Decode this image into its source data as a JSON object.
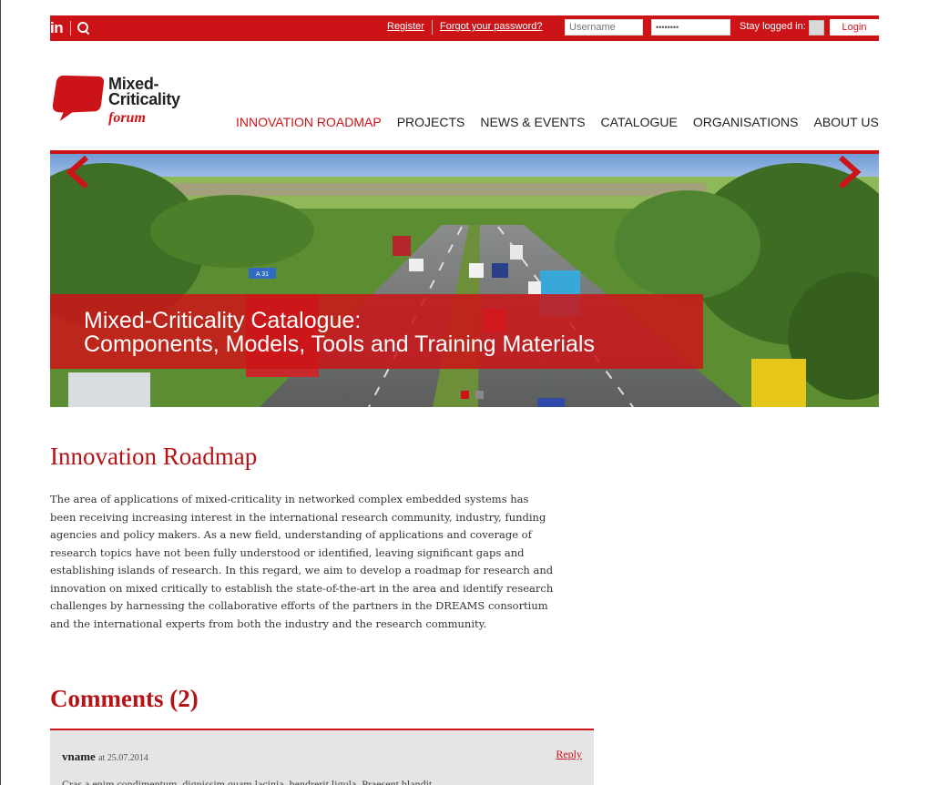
{
  "topbar": {
    "linkedin": "in",
    "register": "Register",
    "forgot": "Forgot your password?",
    "username_placeholder": "Username",
    "password_value": "••••••••",
    "stay_logged": "Stay logged in:",
    "login": "Login"
  },
  "logo": {
    "line1": "Mixed-",
    "line2": "Criticality",
    "line3": "forum"
  },
  "nav": [
    "INNOVATION ROADMAP",
    "PROJECTS",
    "NEWS & EVENTS",
    "CATALOGUE",
    "ORGANISATIONS",
    "ABOUT US"
  ],
  "hero": {
    "line1": "Mixed-Criticality Catalogue:",
    "line2": "Components, Models, Tools and Training Materials",
    "road_sign": "A 31"
  },
  "content": {
    "title": "Innovation Roadmap",
    "paragraph": [
      "The area of applications of mixed-criticality in networked complex embedded systems has",
      "been receiving increasing interest in the international research community, industry, funding",
      "agencies and policy makers. As a new field, understanding of applications and coverage of",
      "research topics have not been fully understood or identified, leaving significant gaps and",
      "establishing islands of research. In this regard, we aim to develop a roadmap for research and",
      "innovation on mixed critically to establish the state-of-the-art in the area and identify research",
      "challenges by harnessing the collaborative efforts of the partners in the DREAMS consortium",
      "and the international experts from both the industry and the research community."
    ]
  },
  "comments": {
    "heading": "Comments (2)",
    "items": [
      {
        "name": "vname",
        "at": "at 25.07.2014",
        "reply": "Reply",
        "text": "Cras a enim condimentum, dignissim quam lacinia, hendrerit ligula. Praesent blandit"
      }
    ]
  },
  "colors": {
    "brand_red": "#cc1418",
    "title_red": "#b51316",
    "comment_bg": "#e5e5e5"
  }
}
